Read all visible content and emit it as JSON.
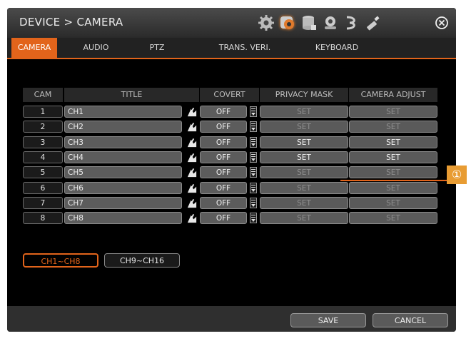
{
  "window": {
    "title": "DEVICE > CAMERA"
  },
  "toolbar": {
    "icons": [
      "system-settings-icon",
      "device-settings-icon",
      "record-storage-icon",
      "event-icon",
      "network-icon",
      "usb-tool-icon"
    ],
    "close_icon": "close-icon"
  },
  "tabs": [
    {
      "label": "CAMERA",
      "active": true
    },
    {
      "label": "AUDIO",
      "active": false
    },
    {
      "label": "PTZ",
      "active": false
    },
    {
      "label": "TRANS. VERI.",
      "active": false
    },
    {
      "label": "KEYBOARD",
      "active": false
    }
  ],
  "table": {
    "headers": [
      "CAM",
      "TITLE",
      "COVERT",
      "PRIVACY MASK",
      "CAMERA ADJUST"
    ],
    "rows": [
      {
        "cam": "1",
        "title": "CH1",
        "covert": "OFF",
        "privacy": "SET",
        "adjust": "SET",
        "enabled": false
      },
      {
        "cam": "2",
        "title": "CH2",
        "covert": "OFF",
        "privacy": "SET",
        "adjust": "SET",
        "enabled": false
      },
      {
        "cam": "3",
        "title": "CH3",
        "covert": "OFF",
        "privacy": "SET",
        "adjust": "SET",
        "enabled": true
      },
      {
        "cam": "4",
        "title": "CH4",
        "covert": "OFF",
        "privacy": "SET",
        "adjust": "SET",
        "enabled": true
      },
      {
        "cam": "5",
        "title": "CH5",
        "covert": "OFF",
        "privacy": "SET",
        "adjust": "SET",
        "enabled": false
      },
      {
        "cam": "6",
        "title": "CH6",
        "covert": "OFF",
        "privacy": "SET",
        "adjust": "SET",
        "enabled": false
      },
      {
        "cam": "7",
        "title": "CH7",
        "covert": "OFF",
        "privacy": "SET",
        "adjust": "SET",
        "enabled": false
      },
      {
        "cam": "8",
        "title": "CH8",
        "covert": "OFF",
        "privacy": "SET",
        "adjust": "SET",
        "enabled": false
      }
    ]
  },
  "pages": [
    {
      "label": "CH1~CH8",
      "active": true
    },
    {
      "label": "CH9~CH16",
      "active": false
    }
  ],
  "footer": {
    "save_label": "SAVE",
    "cancel_label": "CANCEL"
  },
  "callout": {
    "label": "①"
  },
  "colors": {
    "accent": "#e2641b",
    "callout": "#e89c33",
    "background": "#000000"
  }
}
